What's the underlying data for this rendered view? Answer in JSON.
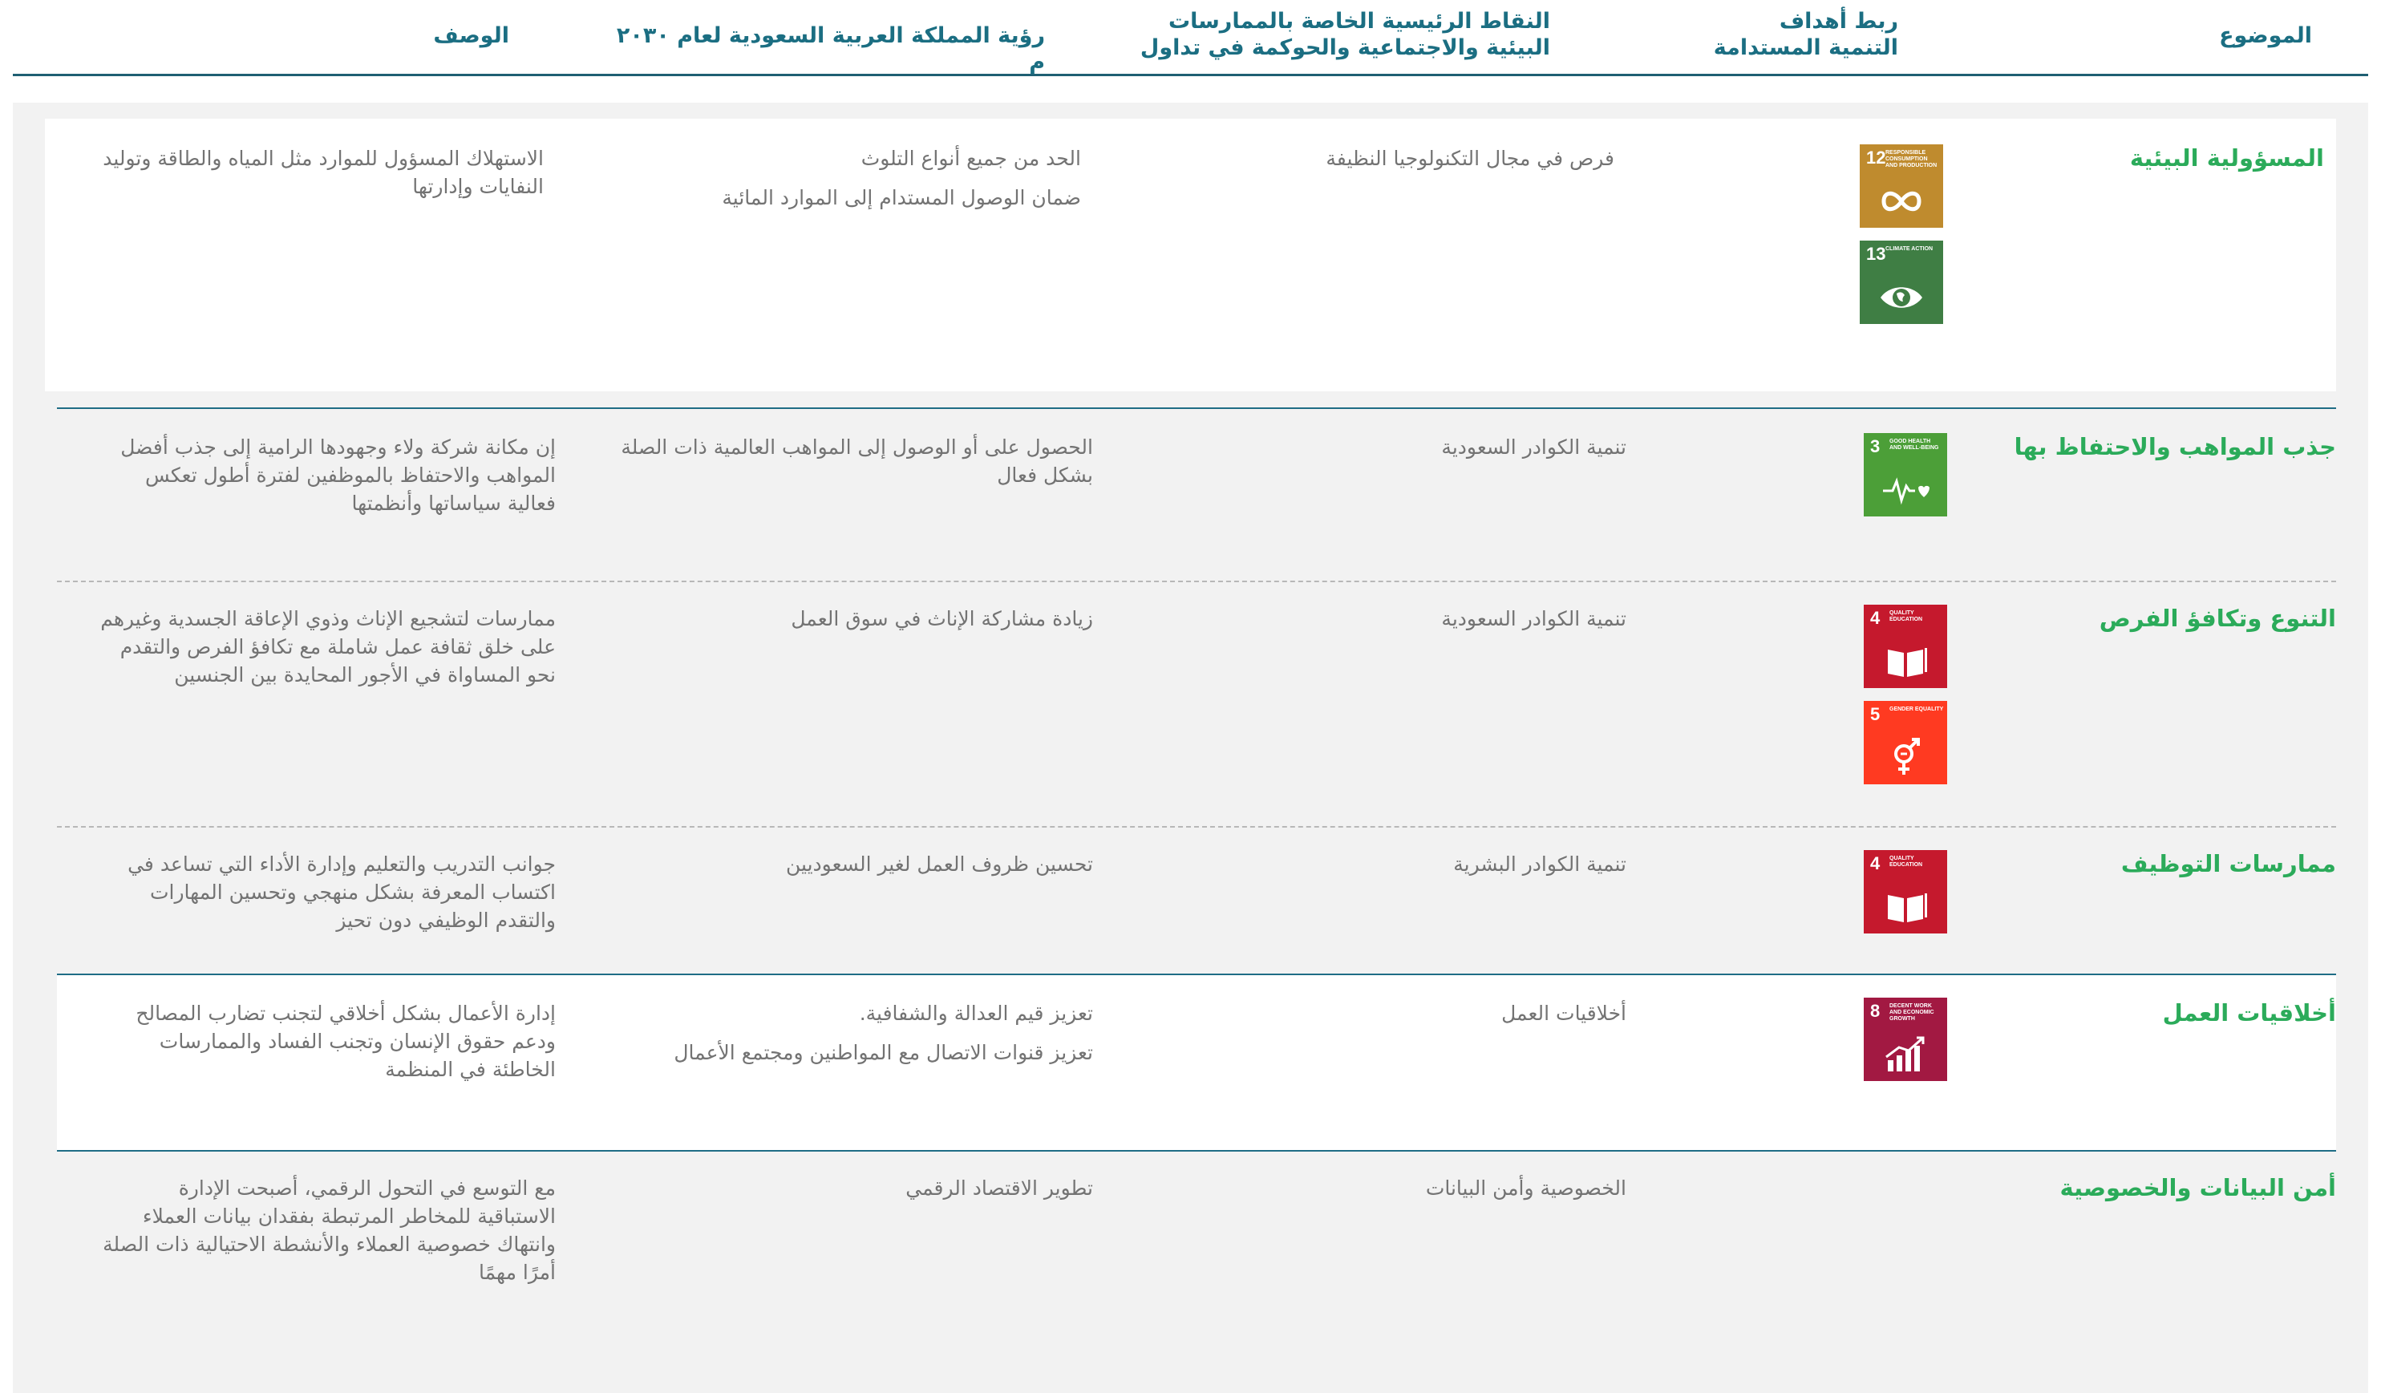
{
  "header": {
    "topic": "الموضوع",
    "sdg": "ربط أهداف\nالتنمية المستدامة",
    "esg": "النقاط الرئيسية الخاصة بالممارسات\nالبيئية والاجتماعية والحوكمة في تداول",
    "vision": "رؤية المملكة العربية السعودية لعام ٢٠٣٠ م",
    "description": "الوصف"
  },
  "rows": [
    {
      "topic": "المسؤولية البيئية",
      "esg": "فرص في مجال التكنولوجيا النظيفة",
      "vision": [
        "الحد من جميع أنواع التلوث",
        "ضمان الوصول المستدام إلى الموارد المائية"
      ],
      "description": "الاستهلاك المسؤول للموارد مثل المياه والطاقة وتوليد النفايات وإدارتها",
      "sdgs": [
        {
          "number": "12",
          "label": "Responsible consumption and production",
          "color": "#bf8b2e",
          "icon": "infinity-icon"
        },
        {
          "number": "13",
          "label": "Climate action",
          "color": "#3f7e44",
          "icon": "eye-globe-icon"
        }
      ]
    },
    {
      "topic": "جذب المواهب والاحتفاظ بها",
      "esg": "تنمية الكوادر السعودية",
      "vision": [
        "الحصول على أو الوصول إلى المواهب العالمية ذات الصلة بشكل فعال"
      ],
      "description": "إن مكانة شركة ولاء وجهودها الرامية إلى جذب أفضل المواهب والاحتفاظ بالموظفين لفترة أطول تعكس فعالية سياساتها وأنظمتها",
      "sdgs": [
        {
          "number": "3",
          "label": "Good health and well-being",
          "color": "#4c9f38",
          "icon": "heartbeat-icon"
        }
      ]
    },
    {
      "topic": "التنوع وتكافؤ الفرص",
      "esg": "تنمية الكوادر السعودية",
      "vision": [
        "زيادة مشاركة الإناث في سوق العمل"
      ],
      "description": "ممارسات لتشجيع الإناث وذوي الإعاقة الجسدية وغيرهم على خلق ثقافة عمل شاملة مع تكافؤ الفرص والتقدم نحو المساواة في الأجور المحايدة بين الجنسين",
      "sdgs": [
        {
          "number": "4",
          "label": "Quality education",
          "color": "#c5192d",
          "icon": "book-icon"
        },
        {
          "number": "5",
          "label": "Gender equality",
          "color": "#ff3a21",
          "icon": "gender-icon"
        }
      ]
    },
    {
      "topic": "ممارسات التوظيف",
      "esg": "تنمية الكوادر البشرية",
      "vision": [
        "تحسين ظروف العمل لغير السعوديين"
      ],
      "description": "جوانب التدريب والتعليم وإدارة الأداء التي تساعد في اكتساب المعرفة بشكل منهجي وتحسين المهارات والتقدم الوظيفي دون تحيز",
      "sdgs": [
        {
          "number": "4",
          "label": "Quality education",
          "color": "#c5192d",
          "icon": "book-icon"
        }
      ]
    },
    {
      "topic": "أخلاقيات العمل",
      "esg": "أخلاقيات العمل",
      "vision": [
        "تعزيز قيم العدالة والشفافية.",
        "تعزيز قنوات الاتصال مع المواطنين ومجتمع الأعمال"
      ],
      "description": "إدارة الأعمال بشكل أخلاقي لتجنب تضارب المصالح ودعم حقوق الإنسان وتجنب الفساد والممارسات الخاطئة في المنظمة",
      "sdgs": [
        {
          "number": "8",
          "label": "Decent work and economic growth",
          "color": "#a21942",
          "icon": "growth-chart-icon"
        }
      ]
    },
    {
      "topic": "أمن البيانات والخصوصية",
      "esg": "الخصوصية وأمن البيانات",
      "vision": [
        "تطوير الاقتصاد الرقمي"
      ],
      "description": "مع التوسع في التحول الرقمي، أصبحت الإدارة الاستباقية للمخاطر المرتبطة بفقدان بيانات العملاء وانتهاك خصوصية العملاء والأنشطة الاحتيالية ذات الصلة أمرًا مهمًا",
      "sdgs": []
    }
  ]
}
